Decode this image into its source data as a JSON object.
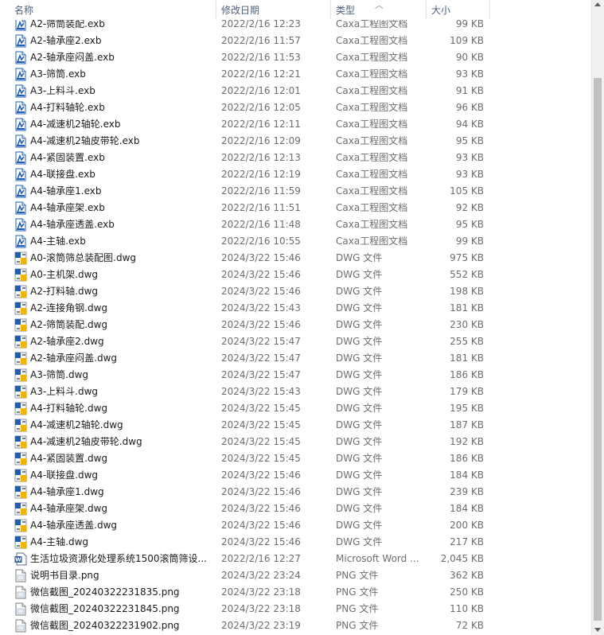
{
  "columns": {
    "name": "名称",
    "date": "修改日期",
    "type": "类型",
    "size": "大小"
  },
  "colors": {
    "header_text": "#4c607a",
    "icon_blue": "#1e5fb4",
    "dwg_yellow": "#f2b400"
  },
  "files": [
    {
      "name": "A2-筛筒装配.exb",
      "date": "2022/2/16 12:23",
      "type": "Caxa工程图文档",
      "size": "99 KB",
      "icon": "exb-icon"
    },
    {
      "name": "A2-轴承座2.exb",
      "date": "2022/2/16 11:57",
      "type": "Caxa工程图文档",
      "size": "109 KB",
      "icon": "exb-icon"
    },
    {
      "name": "A2-轴承座闷盖.exb",
      "date": "2022/2/16 11:53",
      "type": "Caxa工程图文档",
      "size": "90 KB",
      "icon": "exb-icon"
    },
    {
      "name": "A3-筛筒.exb",
      "date": "2022/2/16 12:21",
      "type": "Caxa工程图文档",
      "size": "93 KB",
      "icon": "exb-icon"
    },
    {
      "name": "A3-上料斗.exb",
      "date": "2022/2/16 12:01",
      "type": "Caxa工程图文档",
      "size": "91 KB",
      "icon": "exb-icon"
    },
    {
      "name": "A4-打料轴轮.exb",
      "date": "2022/2/16 12:05",
      "type": "Caxa工程图文档",
      "size": "96 KB",
      "icon": "exb-icon"
    },
    {
      "name": "A4-减速机2轴轮.exb",
      "date": "2022/2/16 12:11",
      "type": "Caxa工程图文档",
      "size": "94 KB",
      "icon": "exb-icon"
    },
    {
      "name": "A4-减速机2轴皮带轮.exb",
      "date": "2022/2/16 12:09",
      "type": "Caxa工程图文档",
      "size": "95 KB",
      "icon": "exb-icon"
    },
    {
      "name": "A4-紧固装置.exb",
      "date": "2022/2/16 12:13",
      "type": "Caxa工程图文档",
      "size": "93 KB",
      "icon": "exb-icon"
    },
    {
      "name": "A4-联接盘.exb",
      "date": "2022/2/16 12:19",
      "type": "Caxa工程图文档",
      "size": "93 KB",
      "icon": "exb-icon"
    },
    {
      "name": "A4-轴承座1.exb",
      "date": "2022/2/16 11:59",
      "type": "Caxa工程图文档",
      "size": "105 KB",
      "icon": "exb-icon"
    },
    {
      "name": "A4-轴承座架.exb",
      "date": "2022/2/16 11:51",
      "type": "Caxa工程图文档",
      "size": "92 KB",
      "icon": "exb-icon"
    },
    {
      "name": "A4-轴承座透盖.exb",
      "date": "2022/2/16 11:48",
      "type": "Caxa工程图文档",
      "size": "95 KB",
      "icon": "exb-icon"
    },
    {
      "name": "A4-主轴.exb",
      "date": "2022/2/16 10:55",
      "type": "Caxa工程图文档",
      "size": "99 KB",
      "icon": "exb-icon"
    },
    {
      "name": "A0-滚筒筛总装配图.dwg",
      "date": "2024/3/22 15:46",
      "type": "DWG 文件",
      "size": "975 KB",
      "icon": "dwg-icon"
    },
    {
      "name": "A0-主机架.dwg",
      "date": "2024/3/22 15:46",
      "type": "DWG 文件",
      "size": "552 KB",
      "icon": "dwg-icon"
    },
    {
      "name": "A2-打料轴.dwg",
      "date": "2024/3/22 15:46",
      "type": "DWG 文件",
      "size": "198 KB",
      "icon": "dwg-icon"
    },
    {
      "name": "A2-连接角钢.dwg",
      "date": "2024/3/22 15:43",
      "type": "DWG 文件",
      "size": "181 KB",
      "icon": "dwg-icon"
    },
    {
      "name": "A2-筛筒装配.dwg",
      "date": "2024/3/22 15:46",
      "type": "DWG 文件",
      "size": "230 KB",
      "icon": "dwg-icon"
    },
    {
      "name": "A2-轴承座2.dwg",
      "date": "2024/3/22 15:47",
      "type": "DWG 文件",
      "size": "255 KB",
      "icon": "dwg-icon"
    },
    {
      "name": "A2-轴承座闷盖.dwg",
      "date": "2024/3/22 15:47",
      "type": "DWG 文件",
      "size": "181 KB",
      "icon": "dwg-icon"
    },
    {
      "name": "A3-筛筒.dwg",
      "date": "2024/3/22 15:47",
      "type": "DWG 文件",
      "size": "186 KB",
      "icon": "dwg-icon"
    },
    {
      "name": "A3-上料斗.dwg",
      "date": "2024/3/22 15:43",
      "type": "DWG 文件",
      "size": "179 KB",
      "icon": "dwg-icon"
    },
    {
      "name": "A4-打料轴轮.dwg",
      "date": "2024/3/22 15:45",
      "type": "DWG 文件",
      "size": "195 KB",
      "icon": "dwg-icon"
    },
    {
      "name": "A4-减速机2轴轮.dwg",
      "date": "2024/3/22 15:45",
      "type": "DWG 文件",
      "size": "187 KB",
      "icon": "dwg-icon"
    },
    {
      "name": "A4-减速机2轴皮带轮.dwg",
      "date": "2024/3/22 15:45",
      "type": "DWG 文件",
      "size": "192 KB",
      "icon": "dwg-icon"
    },
    {
      "name": "A4-紧固装置.dwg",
      "date": "2024/3/22 15:45",
      "type": "DWG 文件",
      "size": "186 KB",
      "icon": "dwg-icon"
    },
    {
      "name": "A4-联接盘.dwg",
      "date": "2024/3/22 15:46",
      "type": "DWG 文件",
      "size": "184 KB",
      "icon": "dwg-icon"
    },
    {
      "name": "A4-轴承座1.dwg",
      "date": "2024/3/22 15:46",
      "type": "DWG 文件",
      "size": "239 KB",
      "icon": "dwg-icon"
    },
    {
      "name": "A4-轴承座架.dwg",
      "date": "2024/3/22 15:46",
      "type": "DWG 文件",
      "size": "184 KB",
      "icon": "dwg-icon"
    },
    {
      "name": "A4-轴承座透盖.dwg",
      "date": "2024/3/22 15:46",
      "type": "DWG 文件",
      "size": "200 KB",
      "icon": "dwg-icon"
    },
    {
      "name": "A4-主轴.dwg",
      "date": "2024/3/22 15:46",
      "type": "DWG 文件",
      "size": "217 KB",
      "icon": "dwg-icon"
    },
    {
      "name": "生活垃圾资源化处理系统1500滚筒筛设...",
      "date": "2022/2/16 12:27",
      "type": "Microsoft Word ...",
      "size": "2,045 KB",
      "icon": "word-icon"
    },
    {
      "name": "说明书目录.png",
      "date": "2024/3/22 23:24",
      "type": "PNG 文件",
      "size": "362 KB",
      "icon": "png-icon"
    },
    {
      "name": "微信截图_20240322231835.png",
      "date": "2024/3/22 23:18",
      "type": "PNG 文件",
      "size": "250 KB",
      "icon": "png-icon"
    },
    {
      "name": "微信截图_20240322231845.png",
      "date": "2024/3/22 23:18",
      "type": "PNG 文件",
      "size": "110 KB",
      "icon": "png-icon"
    },
    {
      "name": "微信截图_20240322231902.png",
      "date": "2024/3/22 23:19",
      "type": "PNG 文件",
      "size": "72 KB",
      "icon": "png-icon"
    }
  ]
}
